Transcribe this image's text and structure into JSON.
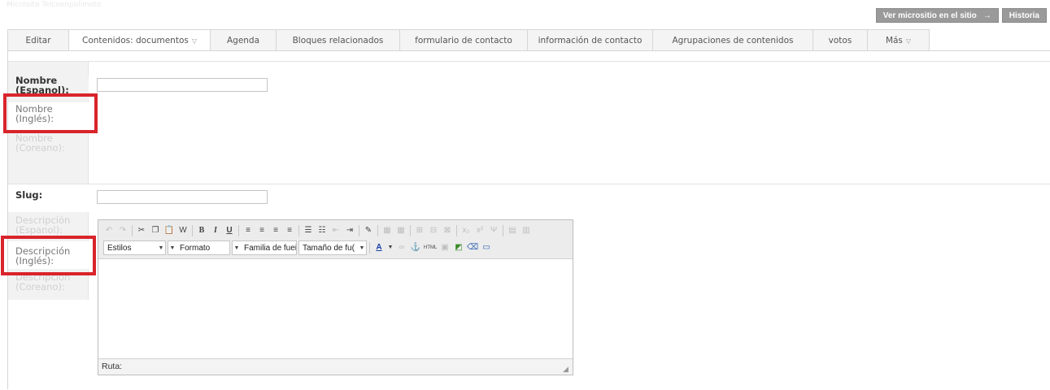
{
  "header": {
    "faint_text": "Microsito  Telcoenpolimoto",
    "view_site_label": "Ver micrositio en el sitio",
    "view_site_arrow": "→",
    "history_label": "Historia"
  },
  "tabs": [
    {
      "label": "Editar",
      "caret": ""
    },
    {
      "label": "Contenidos: documentos",
      "caret": "▽"
    },
    {
      "label": "Agenda",
      "caret": ""
    },
    {
      "label": "Bloques relacionados",
      "caret": ""
    },
    {
      "label": "formulario de contacto",
      "caret": ""
    },
    {
      "label": "información de contacto",
      "caret": ""
    },
    {
      "label": "Agrupaciones de contenidos",
      "caret": ""
    },
    {
      "label": "votos",
      "caret": ""
    },
    {
      "label": "Más",
      "caret": "▽"
    }
  ],
  "name_section": {
    "labels": [
      "Nombre (Espanol):",
      "Nombre (Inglés):",
      "Nombre (Coreano):"
    ],
    "value": ""
  },
  "slug": {
    "label": "Slug:",
    "value": ""
  },
  "description_section": {
    "labels": [
      "Descripción (Espanol):",
      "Descripción (Inglés):",
      "Descripción (Coreano):"
    ]
  },
  "editor": {
    "styles_combo": "Estilos",
    "format_combo": "Formato",
    "font_combo": "Familia de fuei",
    "size_combo": "Tamaño de fu(",
    "path_label": "Ruta:",
    "icon_html": "HTML",
    "toolbar_glyphs": {
      "undo": "↶",
      "redo": "↷",
      "cut": "✂",
      "copy": "❐",
      "paste": "📋",
      "paste_word": "W",
      "bold": "B",
      "italic": "I",
      "underline": "U",
      "align_left": "≡",
      "align_center": "≡",
      "align_right": "≡",
      "align_justify": "≡",
      "bullets": "☰",
      "numbers": "☷",
      "outdent": "⇤",
      "indent": "⇥",
      "edit": "✎",
      "table1": "▦",
      "table2": "▦",
      "t3": "⊞",
      "t4": "⊟",
      "t5": "⊠",
      "sub": "x₂",
      "sup": "x²",
      "clean": "Ψ",
      "t6": "▤",
      "t7": "▥",
      "font_color": "A",
      "link": "∞",
      "anchor": "⚓",
      "image": "▣",
      "media": "◩",
      "eraser": "⌫",
      "template": "▭"
    }
  }
}
